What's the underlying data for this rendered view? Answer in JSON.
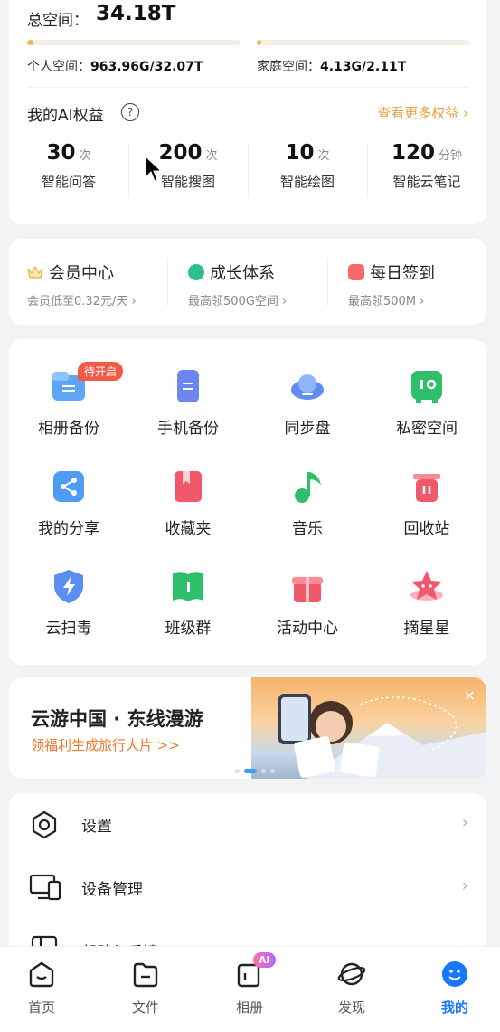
{
  "storage": {
    "total_label": "总空间：",
    "total_value": "34.18T",
    "personal": {
      "label": "个人空间：",
      "value": "963.96G/32.07T",
      "fill": 0.03
    },
    "family": {
      "label": "家庭空间：",
      "value": "4.13G/2.11T",
      "fill": 0.02
    }
  },
  "ai": {
    "title": "我的AI权益",
    "help": "?",
    "more": "查看更多权益",
    "more_chevron": "›",
    "stats": [
      {
        "num": "30",
        "unit": "次",
        "label": "智能问答"
      },
      {
        "num": "200",
        "unit": "次",
        "label": "智能搜图"
      },
      {
        "num": "10",
        "unit": "次",
        "label": "智能绘图"
      },
      {
        "num": "120",
        "unit": "分钟",
        "label": "智能云笔记"
      }
    ]
  },
  "member": [
    {
      "title": "会员中心",
      "sub": "会员低至0.32元/天 ›",
      "icon": "crown-icon"
    },
    {
      "title": "成长体系",
      "sub": "最高领500G空间 ›",
      "icon": "leaf-icon"
    },
    {
      "title": "每日签到",
      "sub": "最高领500M ›",
      "icon": "calendar-icon"
    }
  ],
  "grid": [
    {
      "label": "相册备份",
      "icon": "album-backup-icon",
      "badge": "待开启"
    },
    {
      "label": "手机备份",
      "icon": "phone-backup-icon"
    },
    {
      "label": "同步盘",
      "icon": "cloud-sync-icon"
    },
    {
      "label": "私密空间",
      "icon": "safe-icon"
    },
    {
      "label": "我的分享",
      "icon": "share-icon"
    },
    {
      "label": "收藏夹",
      "icon": "bookmark-icon"
    },
    {
      "label": "音乐",
      "icon": "music-icon"
    },
    {
      "label": "回收站",
      "icon": "trash-icon"
    },
    {
      "label": "云扫毒",
      "icon": "shield-icon"
    },
    {
      "label": "班级群",
      "icon": "book-icon"
    },
    {
      "label": "活动中心",
      "icon": "gift-icon"
    },
    {
      "label": "摘星星",
      "icon": "star-icon"
    }
  ],
  "banner": {
    "title": "云游中国 · 东线漫游",
    "subtitle": "领福利生成旅行大片 >>",
    "close": "×",
    "pages": 4,
    "active_page": 1
  },
  "list": [
    {
      "label": "设置",
      "icon": "gear-icon",
      "chevron": "›"
    },
    {
      "label": "设备管理",
      "icon": "devices-icon",
      "chevron": "›"
    },
    {
      "label": "帮助与反馈",
      "icon": "help-doc-icon",
      "chevron": "›"
    }
  ],
  "tabs": [
    {
      "label": "首页",
      "icon": "home-icon"
    },
    {
      "label": "文件",
      "icon": "folder-icon"
    },
    {
      "label": "相册",
      "icon": "photo-icon",
      "badge": "AI"
    },
    {
      "label": "发现",
      "icon": "planet-icon"
    },
    {
      "label": "我的",
      "icon": "me-icon",
      "active": true
    }
  ],
  "colors": {
    "accent": "#1677ff",
    "gold": "#e7a03c",
    "orange": "#ef7a2b"
  }
}
